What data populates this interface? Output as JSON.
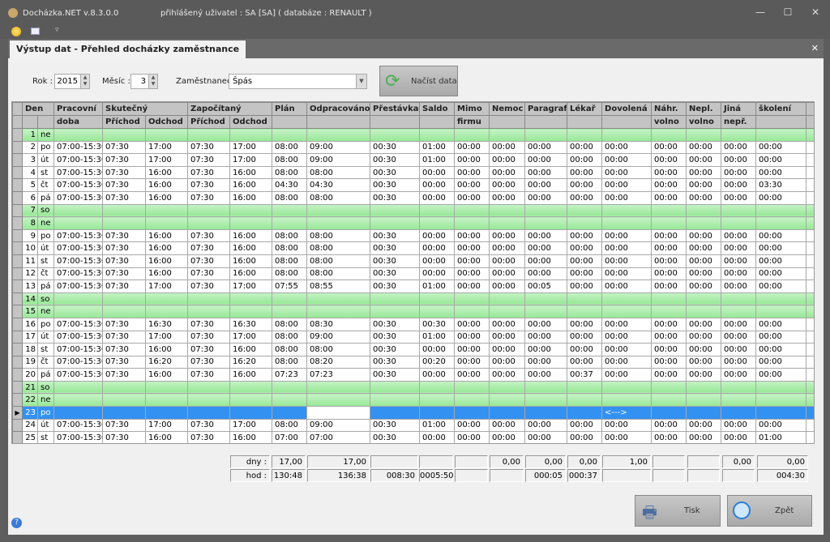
{
  "window": {
    "app_title": "Docházka.NET v.8.3.0.0",
    "user_info": "přihlášený uživatel : SA [SA] ( databáze : RENAULT )",
    "minimize": "—",
    "maximize": "☐",
    "close": "✕"
  },
  "tab": {
    "title": "Výstup dat - Přehled docházky zaměstnance",
    "close": "✕"
  },
  "filters": {
    "year_label": "Rok :",
    "year": "2015",
    "month_label": "Měsíc :",
    "month": "3",
    "employee_label": "Zaměstnanec :",
    "employee": "Špás",
    "load_button": "Načíst data"
  },
  "columns": {
    "row1": [
      "Den",
      "",
      "Pracovní",
      "Skutečný",
      "Započítaný",
      "Plán",
      "Odpracováno",
      "Přestávka",
      "Saldo",
      "Mimo",
      "Nemoc",
      "Paragraf",
      "Lékař",
      "Dovolená",
      "Náhr.",
      "Nepl.",
      "Jiná",
      "školení"
    ],
    "row2": [
      "",
      "",
      "doba",
      "Příchod",
      "Odchod",
      "Příchod",
      "Odchod",
      "",
      "",
      "",
      "",
      "firmu",
      "",
      "",
      "",
      "",
      "volno",
      "volno",
      "nepř.",
      ""
    ]
  },
  "rows": [
    [
      "1",
      "ne",
      "",
      "",
      "",
      "",
      "",
      "",
      "",
      "",
      "",
      "",
      "",
      "",
      "",
      "",
      "",
      "",
      "",
      ""
    ],
    [
      "2",
      "po",
      "07:00-15:30",
      "07:30",
      "17:00",
      "07:30",
      "17:00",
      "08:00",
      "09:00",
      "00:30",
      "01:00",
      "00:00",
      "00:00",
      "00:00",
      "00:00",
      "00:00",
      "00:00",
      "00:00",
      "00:00",
      "00:00"
    ],
    [
      "3",
      "út",
      "07:00-15:30",
      "07:30",
      "17:00",
      "07:30",
      "17:00",
      "08:00",
      "09:00",
      "00:30",
      "01:00",
      "00:00",
      "00:00",
      "00:00",
      "00:00",
      "00:00",
      "00:00",
      "00:00",
      "00:00",
      "00:00"
    ],
    [
      "4",
      "st",
      "07:00-15:30",
      "07:30",
      "16:00",
      "07:30",
      "16:00",
      "08:00",
      "08:00",
      "00:30",
      "00:00",
      "00:00",
      "00:00",
      "00:00",
      "00:00",
      "00:00",
      "00:00",
      "00:00",
      "00:00",
      "00:00"
    ],
    [
      "5",
      "čt",
      "07:00-15:30",
      "07:30",
      "16:00",
      "07:30",
      "16:00",
      "04:30",
      "04:30",
      "00:30",
      "00:00",
      "00:00",
      "00:00",
      "00:00",
      "00:00",
      "00:00",
      "00:00",
      "00:00",
      "00:00",
      "03:30"
    ],
    [
      "6",
      "pá",
      "07:00-15:30",
      "07:30",
      "16:00",
      "07:30",
      "16:00",
      "08:00",
      "08:00",
      "00:30",
      "00:00",
      "00:00",
      "00:00",
      "00:00",
      "00:00",
      "00:00",
      "00:00",
      "00:00",
      "00:00",
      "00:00"
    ],
    [
      "7",
      "so",
      "",
      "",
      "",
      "",
      "",
      "",
      "",
      "",
      "",
      "",
      "",
      "",
      "",
      "",
      "",
      "",
      "",
      ""
    ],
    [
      "8",
      "ne",
      "",
      "",
      "",
      "",
      "",
      "",
      "",
      "",
      "",
      "",
      "",
      "",
      "",
      "",
      "",
      "",
      "",
      ""
    ],
    [
      "9",
      "po",
      "07:00-15:30",
      "07:30",
      "16:00",
      "07:30",
      "16:00",
      "08:00",
      "08:00",
      "00:30",
      "00:00",
      "00:00",
      "00:00",
      "00:00",
      "00:00",
      "00:00",
      "00:00",
      "00:00",
      "00:00",
      "00:00"
    ],
    [
      "10",
      "út",
      "07:00-15:30",
      "07:30",
      "16:00",
      "07:30",
      "16:00",
      "08:00",
      "08:00",
      "00:30",
      "00:00",
      "00:00",
      "00:00",
      "00:00",
      "00:00",
      "00:00",
      "00:00",
      "00:00",
      "00:00",
      "00:00"
    ],
    [
      "11",
      "st",
      "07:00-15:30",
      "07:30",
      "16:00",
      "07:30",
      "16:00",
      "08:00",
      "08:00",
      "00:30",
      "00:00",
      "00:00",
      "00:00",
      "00:00",
      "00:00",
      "00:00",
      "00:00",
      "00:00",
      "00:00",
      "00:00"
    ],
    [
      "12",
      "čt",
      "07:00-15:30",
      "07:30",
      "16:00",
      "07:30",
      "16:00",
      "08:00",
      "08:00",
      "00:30",
      "00:00",
      "00:00",
      "00:00",
      "00:00",
      "00:00",
      "00:00",
      "00:00",
      "00:00",
      "00:00",
      "00:00"
    ],
    [
      "13",
      "pá",
      "07:00-15:30",
      "07:30",
      "17:00",
      "07:30",
      "17:00",
      "07:55",
      "08:55",
      "00:30",
      "01:00",
      "00:00",
      "00:00",
      "00:05",
      "00:00",
      "00:00",
      "00:00",
      "00:00",
      "00:00",
      "00:00"
    ],
    [
      "14",
      "so",
      "",
      "",
      "",
      "",
      "",
      "",
      "",
      "",
      "",
      "",
      "",
      "",
      "",
      "",
      "",
      "",
      "",
      ""
    ],
    [
      "15",
      "ne",
      "",
      "",
      "",
      "",
      "",
      "",
      "",
      "",
      "",
      "",
      "",
      "",
      "",
      "",
      "",
      "",
      "",
      ""
    ],
    [
      "16",
      "po",
      "07:00-15:30",
      "07:30",
      "16:30",
      "07:30",
      "16:30",
      "08:00",
      "08:30",
      "00:30",
      "00:30",
      "00:00",
      "00:00",
      "00:00",
      "00:00",
      "00:00",
      "00:00",
      "00:00",
      "00:00",
      "00:00"
    ],
    [
      "17",
      "út",
      "07:00-15:30",
      "07:30",
      "17:00",
      "07:30",
      "17:00",
      "08:00",
      "09:00",
      "00:30",
      "01:00",
      "00:00",
      "00:00",
      "00:00",
      "00:00",
      "00:00",
      "00:00",
      "00:00",
      "00:00",
      "00:00"
    ],
    [
      "18",
      "st",
      "07:00-15:30",
      "07:30",
      "16:00",
      "07:30",
      "16:00",
      "08:00",
      "08:00",
      "00:30",
      "00:00",
      "00:00",
      "00:00",
      "00:00",
      "00:00",
      "00:00",
      "00:00",
      "00:00",
      "00:00",
      "00:00"
    ],
    [
      "19",
      "čt",
      "07:00-15:30",
      "07:30",
      "16:20",
      "07:30",
      "16:20",
      "08:00",
      "08:20",
      "00:30",
      "00:20",
      "00:00",
      "00:00",
      "00:00",
      "00:00",
      "00:00",
      "00:00",
      "00:00",
      "00:00",
      "00:00"
    ],
    [
      "20",
      "pá",
      "07:00-15:30",
      "07:30",
      "16:00",
      "07:30",
      "16:00",
      "07:23",
      "07:23",
      "00:30",
      "00:00",
      "00:00",
      "00:00",
      "00:00",
      "00:37",
      "00:00",
      "00:00",
      "00:00",
      "00:00",
      "00:00"
    ],
    [
      "21",
      "so",
      "",
      "",
      "",
      "",
      "",
      "",
      "",
      "",
      "",
      "",
      "",
      "",
      "",
      "",
      "",
      "",
      "",
      ""
    ],
    [
      "22",
      "ne",
      "",
      "",
      "",
      "",
      "",
      "",
      "",
      "",
      "",
      "",
      "",
      "",
      "",
      "",
      "",
      "",
      "",
      ""
    ],
    [
      "23",
      "po",
      "",
      "",
      "",
      "",
      "",
      "",
      "",
      "",
      "",
      "",
      "",
      "",
      "",
      "<--->",
      "",
      "",
      "",
      ""
    ],
    [
      "24",
      "út",
      "07:00-15:30",
      "07:30",
      "17:00",
      "07:30",
      "17:00",
      "08:00",
      "09:00",
      "00:30",
      "01:00",
      "00:00",
      "00:00",
      "00:00",
      "00:00",
      "00:00",
      "00:00",
      "00:00",
      "00:00",
      "00:00"
    ],
    [
      "25",
      "st",
      "07:00-15:30",
      "07:30",
      "16:00",
      "07:30",
      "16:00",
      "07:00",
      "07:00",
      "00:30",
      "00:00",
      "00:00",
      "00:00",
      "00:00",
      "00:00",
      "00:00",
      "00:00",
      "00:00",
      "00:00",
      "01:00"
    ]
  ],
  "weekend_rows": [
    1,
    7,
    8,
    14,
    15,
    21,
    22
  ],
  "selected_row": 23,
  "totals": {
    "days": [
      "dny :",
      "17,00",
      "17,00",
      "",
      "",
      "",
      "0,00",
      "0,00",
      "0,00",
      "1,00",
      "",
      "",
      "0,00",
      "0,00"
    ],
    "hours": [
      "hod :",
      "130:48",
      "136:38",
      "008:30",
      "0005:50",
      "",
      "",
      "000:05",
      "000:37",
      "",
      "",
      "",
      "",
      "004:30"
    ]
  },
  "buttons": {
    "print": "Tisk",
    "back": "Zpět"
  },
  "colors": {
    "weekend": "#a8eca8",
    "selected": "#3391f2",
    "header": "#c4c4c4"
  }
}
